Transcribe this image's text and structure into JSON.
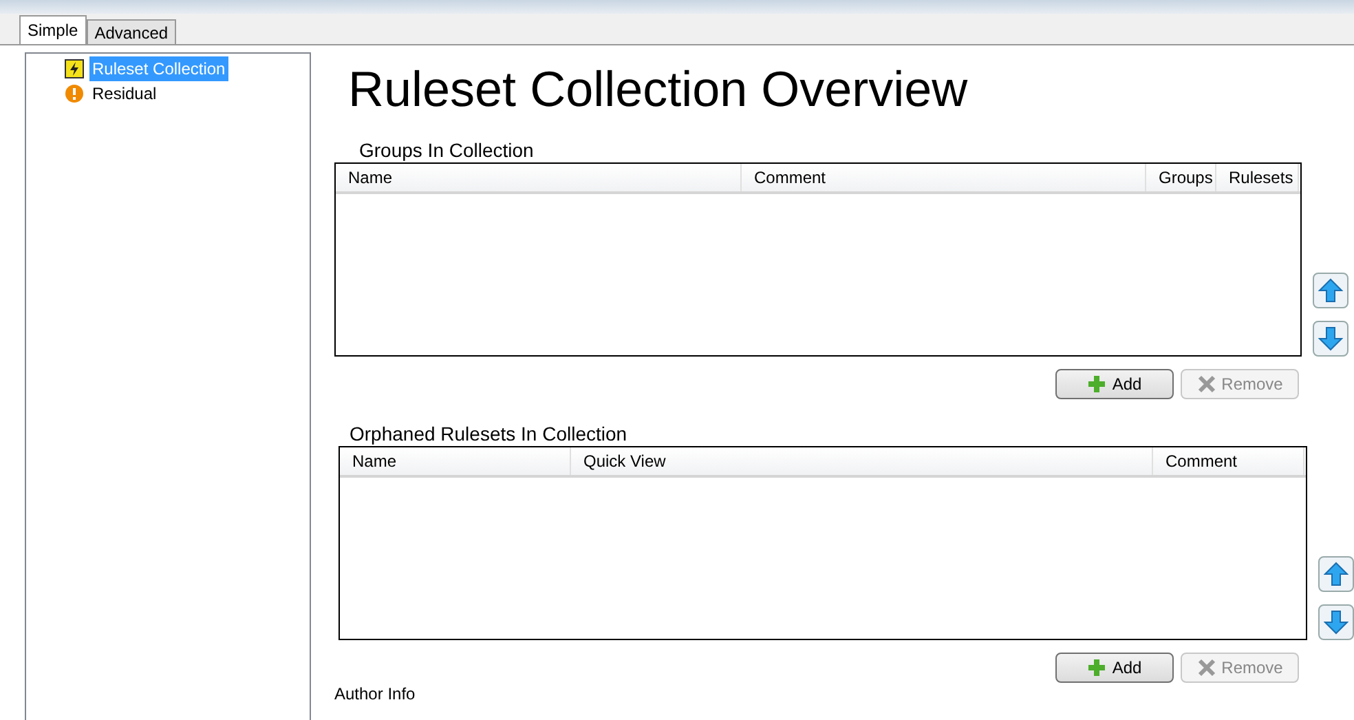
{
  "tabs": [
    {
      "label": "Simple",
      "selected": true
    },
    {
      "label": "Advanced",
      "selected": false
    }
  ],
  "tree": [
    {
      "label": "Ruleset Collection",
      "kind": "collection",
      "selected": true
    },
    {
      "label": "Residual",
      "kind": "residual",
      "selected": false
    }
  ],
  "title": "Ruleset Collection Overview",
  "sections": [
    {
      "label": "Groups In Collection",
      "columns": [
        "Name",
        "Comment",
        "Groups",
        "Rulesets"
      ],
      "buttons": [
        {
          "label": "Add",
          "kind": "add",
          "disabled": false
        },
        {
          "label": "Remove",
          "kind": "remove",
          "disabled": true
        }
      ]
    },
    {
      "label": "Orphaned Rulesets In Collection",
      "columns": [
        "Name",
        "Quick View",
        "Comment"
      ],
      "buttons": [
        {
          "label": "Add",
          "kind": "add",
          "disabled": false
        },
        {
          "label": "Remove",
          "kind": "remove",
          "disabled": true
        }
      ]
    }
  ],
  "footer_label": "Author Info"
}
